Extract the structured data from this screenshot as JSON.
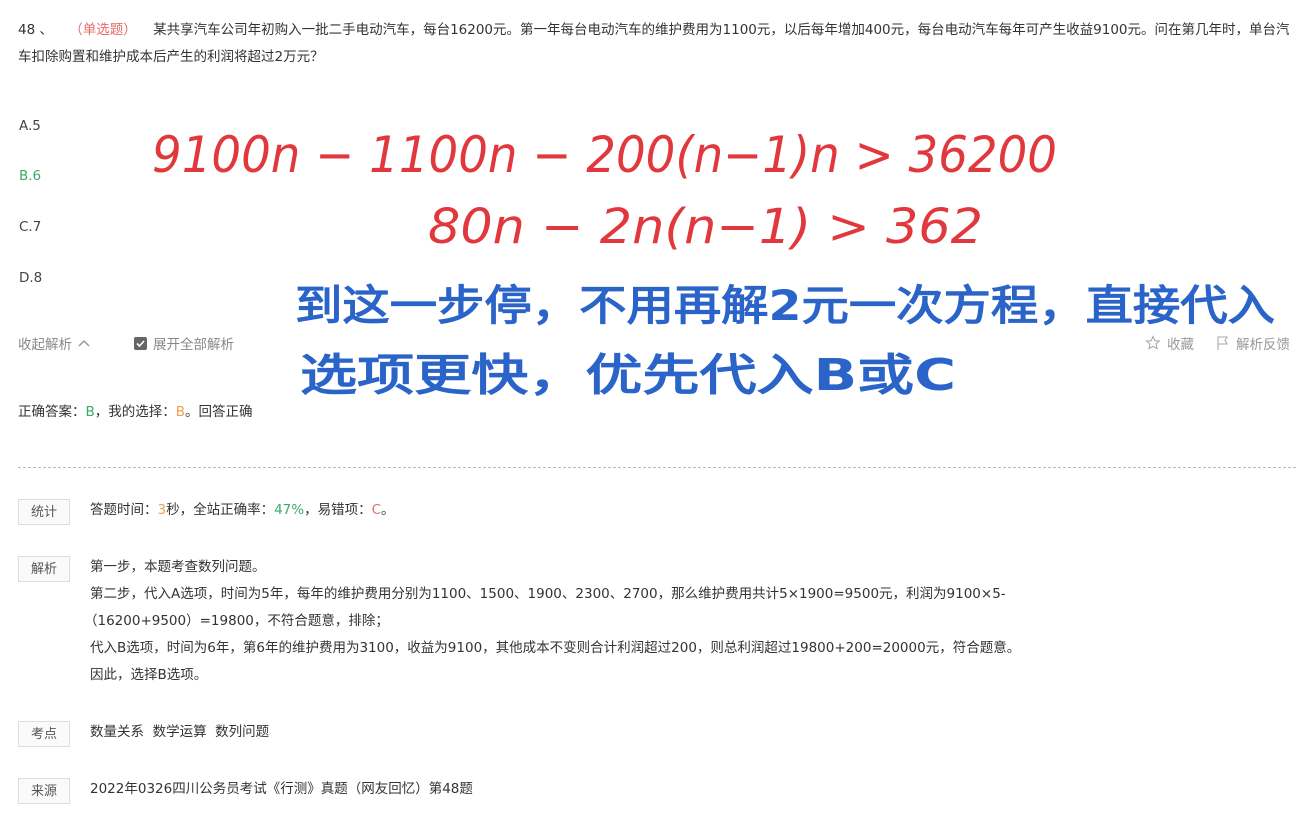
{
  "question": {
    "number": "48 、",
    "type": "（单选题）",
    "text": "某共享汽车公司年初购入一批二手电动汽车，每台16200元。第一年每台电动汽车的维护费用为1100元，以后每年增加400元，每台电动汽车每年可产生收益9100元。问在第几年时，单台汽车扣除购置和维护成本后产生的利润将超过2万元？"
  },
  "options": [
    {
      "label": "A.5"
    },
    {
      "label": "B.6"
    },
    {
      "label": "C.7"
    },
    {
      "label": "D.8"
    }
  ],
  "actions": {
    "collapse_label": "收起解析",
    "expand_all_label": "展开全部解析",
    "favorite_label": "收藏",
    "feedback_label": "解析反馈"
  },
  "answer": {
    "correct_prefix": "正确答案：",
    "correct_value": "B",
    "mine_prefix": "，我的选择：",
    "mine_value": "B",
    "result": "。回答正确"
  },
  "stats": {
    "tag": "统计",
    "time_prefix": "答题时间：",
    "time_value": "3",
    "time_unit": "秒，全站正确率：",
    "rate_value": "47%",
    "wrong_prefix": "，易错项：",
    "wrong_value": "C",
    "end": "。"
  },
  "analysis": {
    "tag": "解析",
    "lines": [
      "第一步，本题考查数列问题。",
      "第二步，代入A选项，时间为5年，每年的维护费用分别为1100、1500、1900、2300、2700，那么维护费用共计5×1900=9500元，利润为9100×5-",
      "（16200+9500）=19800，不符合题意，排除；",
      "代入B选项，时间为6年，第6年的维护费用为3100，收益为9100，其他成本不变则合计利润超过200，则总利润超过19800+200=20000元，符合题意。",
      "因此，选择B选项。"
    ]
  },
  "points": {
    "tag": "考点",
    "value": "数量关系  数学运算  数列问题"
  },
  "source": {
    "tag": "来源",
    "value": "2022年0326四川公务员考试《行测》真题（网友回忆）第48题"
  },
  "handwriting": {
    "red_line1": "9100n − 1100n − 200(n−1)n > 36200",
    "red_line2": "80n − 2n(n−1) > 362",
    "blue_line1": "到这一步停，不用再解2元一次方程，直接代入",
    "blue_line2": "选项更快，优先代入B或C",
    "red_color": "#e0383c",
    "blue_color": "#2a64c8"
  }
}
